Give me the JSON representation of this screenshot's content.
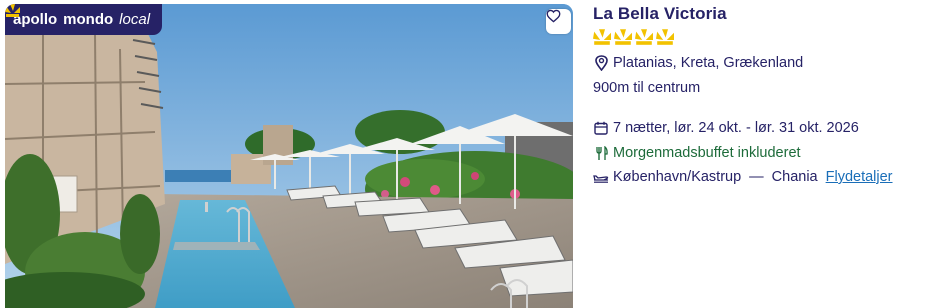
{
  "brand": {
    "part1": "apollo",
    "part2": "mondo",
    "part3": "local"
  },
  "hotel": {
    "name": "La Bella Victoria",
    "stars": 4,
    "location": "Platanias, Kreta, Grækenland",
    "distance": "900m til centrum"
  },
  "trip": {
    "dates": "7 nætter, lør. 24 okt. - lør. 31 okt. 2026",
    "board": "Morgenmadsbuffet inkluderet",
    "departure": "København/Kastrup",
    "separator": "—",
    "arrival": "Chania",
    "flight_details_link": "Flydetaljer"
  },
  "colors": {
    "navy": "#262266",
    "star": "#f2c200",
    "green": "#1d6b3a",
    "link": "#1a6eb8"
  },
  "icons": [
    "heart-icon",
    "star-icon",
    "location-pin-icon",
    "calendar-icon",
    "cutlery-icon",
    "plane-icon"
  ]
}
